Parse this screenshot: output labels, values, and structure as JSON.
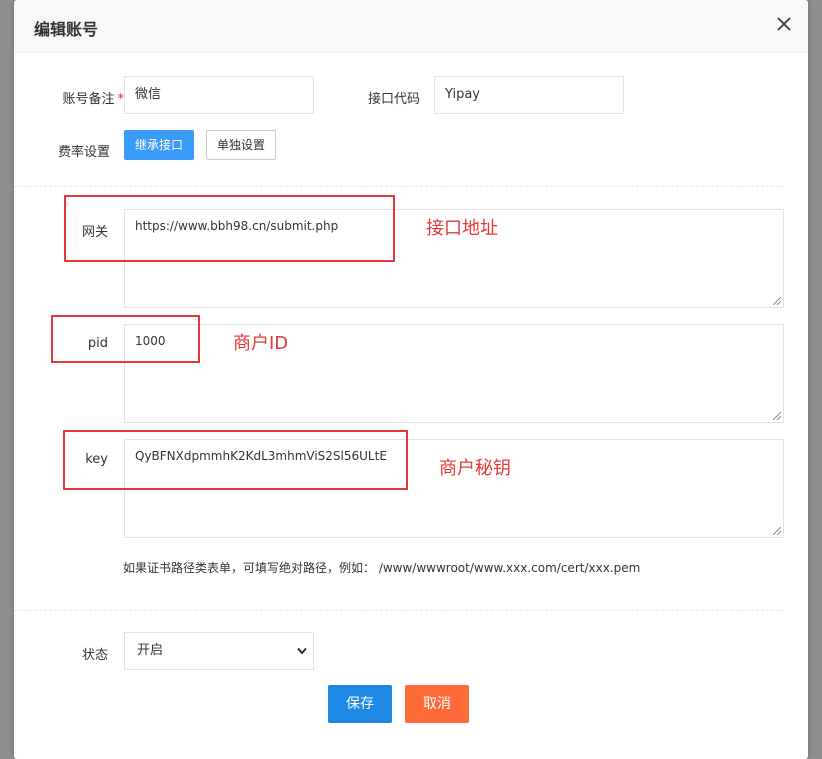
{
  "dialog": {
    "title": "编辑账号"
  },
  "form": {
    "account_note": {
      "label": "账号备注",
      "required_mark": "*",
      "value": "微信"
    },
    "interface_code": {
      "label": "接口代码",
      "value": "Yipay"
    },
    "rate_setting": {
      "label": "费率设置",
      "inherit_label": "继承接口",
      "separate_label": "单独设置"
    },
    "gateway": {
      "label": "网关",
      "value": "https://www.bbh98.cn/submit.php"
    },
    "pid": {
      "label": "pid",
      "value": "1000"
    },
    "key": {
      "label": "key",
      "value": "QyBFNXdpmmhK2KdL3mhmViS2Sl56ULtE"
    },
    "hint": "如果证书路径类表单，可填写绝对路径，例如： /www/wwwroot/www.xxx.com/cert/xxx.pem",
    "status": {
      "label": "状态",
      "selected": "开启"
    }
  },
  "annotations": {
    "gateway": "接口地址",
    "pid": "商户ID",
    "key": "商户秘钥"
  },
  "actions": {
    "save_label": "保存",
    "cancel_label": "取消"
  },
  "colors": {
    "primary": "#3a9cf8",
    "save": "#1e88e5",
    "cancel": "#ff6a3a",
    "annotation": "#e53935",
    "required": "#e0231b"
  },
  "icons": {
    "close": "close-icon",
    "dropdown": "chevron-down-icon",
    "resize": "resize-grip-icon"
  }
}
